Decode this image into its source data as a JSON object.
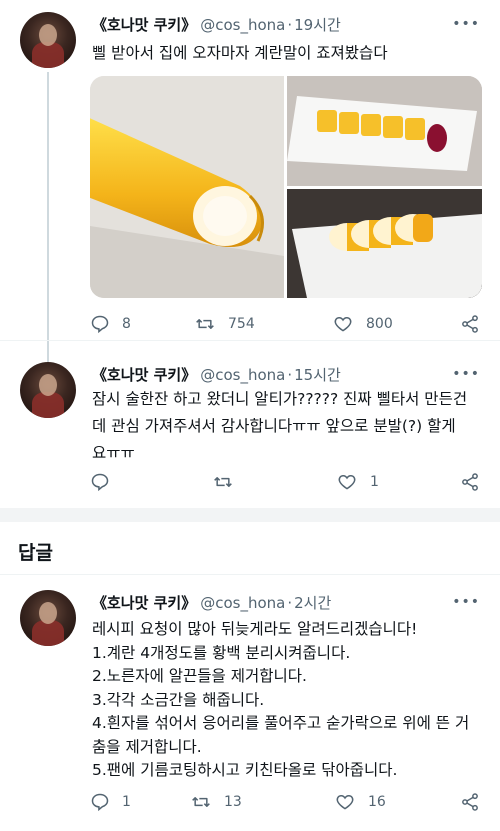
{
  "tweets": [
    {
      "name": "《호나맛 쿠키》",
      "handle": "@cos_hona",
      "dot": "·",
      "time": "19시간",
      "text": [
        "삘 받아서 집에 오자마자 계란말이 죠져봤습다"
      ],
      "replies": "8",
      "retweets": "754",
      "likes": "800"
    },
    {
      "name": "《호나맛 쿠키》",
      "handle": "@cos_hona",
      "dot": "·",
      "time": "15시간",
      "text": [
        "잠시 술한잔 하고 왔더니 알티가????? 진짜 삘타서 만든건",
        "데 관심 가져주셔서 감사합니다ㅠㅠ 앞으로 분발(?) 할게",
        "요ㅠㅠ"
      ],
      "replies": "",
      "retweets": "",
      "likes": "1"
    },
    {
      "name": "《호나맛 쿠키》",
      "handle": "@cos_hona",
      "dot": "·",
      "time": "2시간",
      "text": [
        "레시피 요청이 많아 뒤늦게라도 알려드리겠습니다!",
        "1.계란 4개정도를 황백 분리시켜줍니다.",
        "2.노른자에 알끈들을 제거합니다.",
        "3.각각 소금간을 해줍니다.",
        "4.흰자를 섞어서 응어리를 풀어주고 숟가락으로 위에 뜬 거",
        "춤을 제거합니다.",
        "5.팬에 기름코팅하시고 키친타올로 닦아줍니다."
      ],
      "replies": "1",
      "retweets": "13",
      "likes": "16"
    }
  ],
  "section": {
    "title": "답글"
  },
  "colors": {
    "text": "#0f1419",
    "muted": "#536471",
    "yolk": "#f4b41a"
  }
}
